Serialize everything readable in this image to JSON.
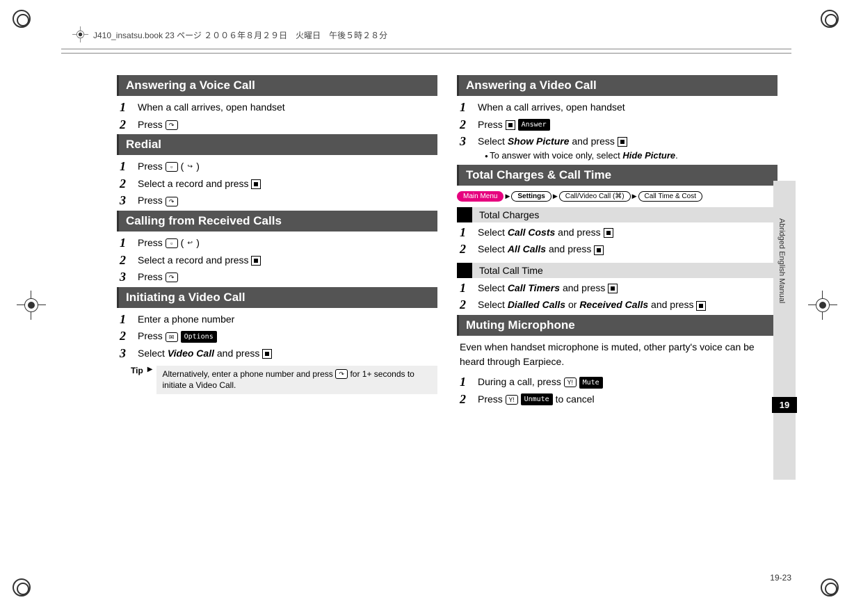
{
  "header": "J410_insatsu.book  23 ページ  ２００６年８月２９日　火曜日　午後５時２８分",
  "left": {
    "s1": {
      "title": "Answering a Voice Call",
      "step1": "When a call arrives, open handset",
      "step2": "Press"
    },
    "s2": {
      "title": "Redial",
      "step1a": "Press",
      "step2": "Select a record and press",
      "step3": "Press"
    },
    "s3": {
      "title": "Calling from Received Calls",
      "step1a": "Press",
      "step2": "Select a record and press",
      "step3": "Press"
    },
    "s4": {
      "title": "Initiating a Video Call",
      "step1": "Enter a phone number",
      "step2": "Press",
      "step2_soft": "Options",
      "step3a": "Select",
      "step3b": "Video Call",
      "step3c": "and press",
      "tip_label": "Tip",
      "tip": "Alternatively, enter a phone number and press",
      "tip2": "for 1+ seconds to initiate a Video Call."
    }
  },
  "right": {
    "s1": {
      "title": "Answering a Video Call",
      "step1": "When a call arrives, open handset",
      "step2": "Press",
      "step2_soft": "Answer",
      "step3a": "Select",
      "step3b": "Show Picture",
      "step3c": "and press",
      "bullet_a": "To answer with voice only, select",
      "bullet_b": "Hide Picture",
      "bullet_c": "."
    },
    "s2": {
      "title": "Total Charges & Call Time",
      "nav": {
        "main": "Main Menu",
        "b": "Settings",
        "c": "Call/Video Call (⌘)",
        "d": "Call Time & Cost"
      },
      "sub1": "Total Charges",
      "s1_1a": "Select",
      "s1_1b": "Call Costs",
      "s1_1c": "and press",
      "s1_2a": "Select",
      "s1_2b": "All Calls",
      "s1_2c": "and press",
      "sub2": "Total Call Time",
      "s2_1a": "Select",
      "s2_1b": "Call Timers",
      "s2_1c": "and press",
      "s2_2a": "Select",
      "s2_2b": "Dialled Calls",
      "s2_2c": "or",
      "s2_2d": "Received Calls",
      "s2_2e": "and press"
    },
    "s3": {
      "title": "Muting Microphone",
      "intro": "Even when handset microphone is muted, other party's voice can be heard through Earpiece.",
      "step1": "During a call, press",
      "step1_soft": "Mute",
      "step2a": "Press",
      "step2_soft": "Unmute",
      "step2b": "to cancel"
    }
  },
  "sidebar": {
    "text": "Abridged English Manual",
    "chapter": "19"
  },
  "page_number": "19-23"
}
